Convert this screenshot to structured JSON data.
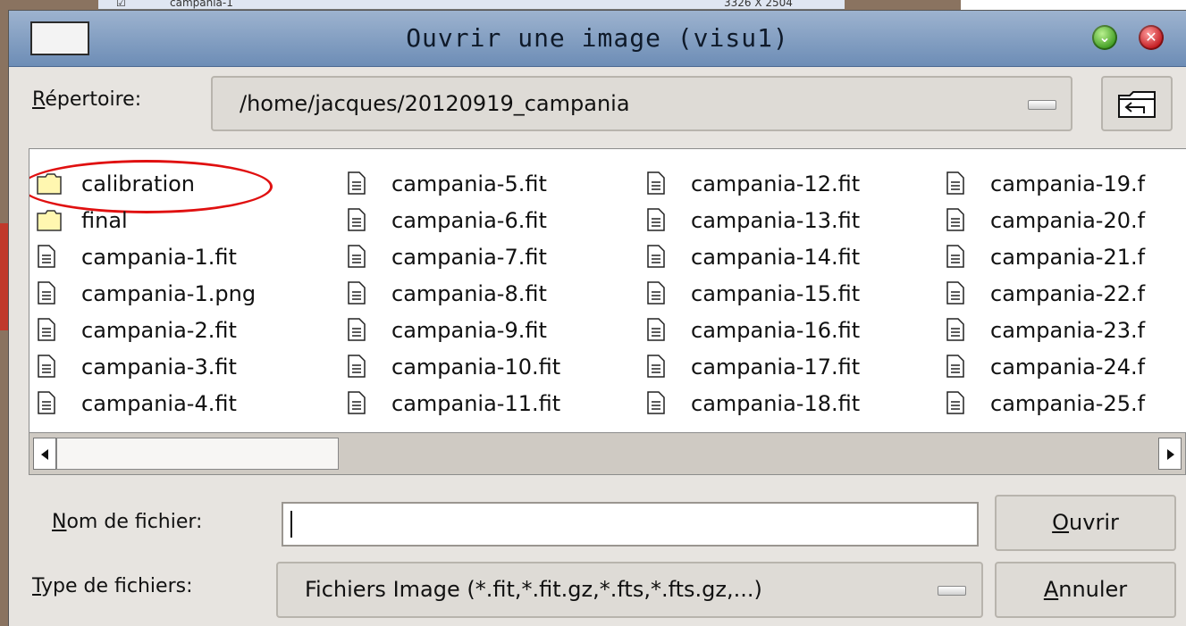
{
  "dialog": {
    "title": "Ouvrir une image (visu1)"
  },
  "background": {
    "strip_name": "campania-1",
    "strip_size": "3326 X 2504"
  },
  "directory": {
    "label_mnemonic": "R",
    "label_rest": "épertoire:",
    "path": "/home/jacques/20120919_campania"
  },
  "files": {
    "columns": [
      [
        {
          "name": "calibration",
          "icon": "folder-icon"
        },
        {
          "name": "final",
          "icon": "folder-icon"
        },
        {
          "name": "campania-1.fit",
          "icon": "file-icon"
        },
        {
          "name": "campania-1.png",
          "icon": "file-icon"
        },
        {
          "name": "campania-2.fit",
          "icon": "file-icon"
        },
        {
          "name": "campania-3.fit",
          "icon": "file-icon"
        },
        {
          "name": "campania-4.fit",
          "icon": "file-icon"
        }
      ],
      [
        {
          "name": "campania-5.fit",
          "icon": "file-icon"
        },
        {
          "name": "campania-6.fit",
          "icon": "file-icon"
        },
        {
          "name": "campania-7.fit",
          "icon": "file-icon"
        },
        {
          "name": "campania-8.fit",
          "icon": "file-icon"
        },
        {
          "name": "campania-9.fit",
          "icon": "file-icon"
        },
        {
          "name": "campania-10.fit",
          "icon": "file-icon"
        },
        {
          "name": "campania-11.fit",
          "icon": "file-icon"
        }
      ],
      [
        {
          "name": "campania-12.fit",
          "icon": "file-icon"
        },
        {
          "name": "campania-13.fit",
          "icon": "file-icon"
        },
        {
          "name": "campania-14.fit",
          "icon": "file-icon"
        },
        {
          "name": "campania-15.fit",
          "icon": "file-icon"
        },
        {
          "name": "campania-16.fit",
          "icon": "file-icon"
        },
        {
          "name": "campania-17.fit",
          "icon": "file-icon"
        },
        {
          "name": "campania-18.fit",
          "icon": "file-icon"
        }
      ],
      [
        {
          "name": "campania-19.f",
          "icon": "file-icon"
        },
        {
          "name": "campania-20.f",
          "icon": "file-icon"
        },
        {
          "name": "campania-21.f",
          "icon": "file-icon"
        },
        {
          "name": "campania-22.f",
          "icon": "file-icon"
        },
        {
          "name": "campania-23.f",
          "icon": "file-icon"
        },
        {
          "name": "campania-24.f",
          "icon": "file-icon"
        },
        {
          "name": "campania-25.f",
          "icon": "file-icon"
        }
      ]
    ],
    "highlighted": "calibration"
  },
  "filename": {
    "label_mnemonic": "N",
    "label_rest": "om de fichier:",
    "value": ""
  },
  "filetype": {
    "label_mnemonic": "T",
    "label_rest": "ype de fichiers:",
    "value": "Fichiers Image (*.fit,*.fit.gz,*.fts,*.fts.gz,...)"
  },
  "buttons": {
    "open_mnemonic": "O",
    "open_rest": "uvrir",
    "cancel_mnemonic": "A",
    "cancel_rest": "nnuler"
  },
  "colors": {
    "titlebar": "#7f9cc2",
    "dialog_bg": "#e7e4e0",
    "highlight": "#e01010",
    "folder": "#fff7b0"
  }
}
